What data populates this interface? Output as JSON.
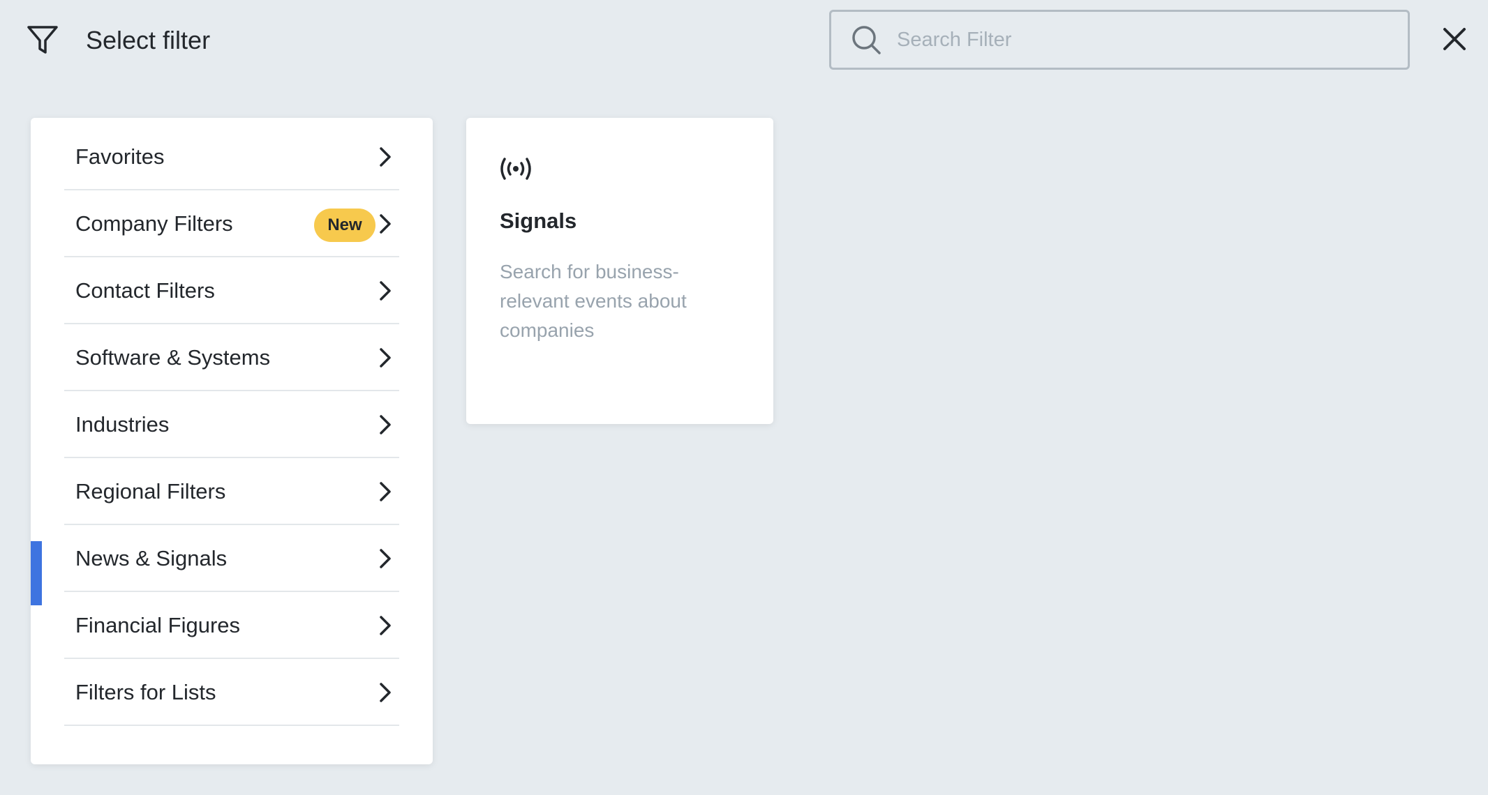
{
  "header": {
    "icon": "filter-icon",
    "title": "Select filter",
    "search_placeholder": "Search Filter",
    "search_value": "",
    "close_icon": "close-icon"
  },
  "menu": {
    "items": [
      {
        "label": "Favorites"
      },
      {
        "label": "Company Filters",
        "badge": "New"
      },
      {
        "label": "Contact Filters"
      },
      {
        "label": "Software & Systems"
      },
      {
        "label": "Industries"
      },
      {
        "label": "Regional Filters"
      },
      {
        "label": "News & Signals",
        "active": true
      },
      {
        "label": "Financial Figures"
      },
      {
        "label": "Filters for Lists"
      }
    ]
  },
  "signals_card": {
    "icon": "broadcast-icon",
    "title": "Signals",
    "description": "Search for business-relevant events about companies"
  },
  "colors": {
    "background": "#e6ebef",
    "accent_active": "#3e74e0",
    "badge": "#f7c94d",
    "muted_text": "#98a3ad"
  }
}
